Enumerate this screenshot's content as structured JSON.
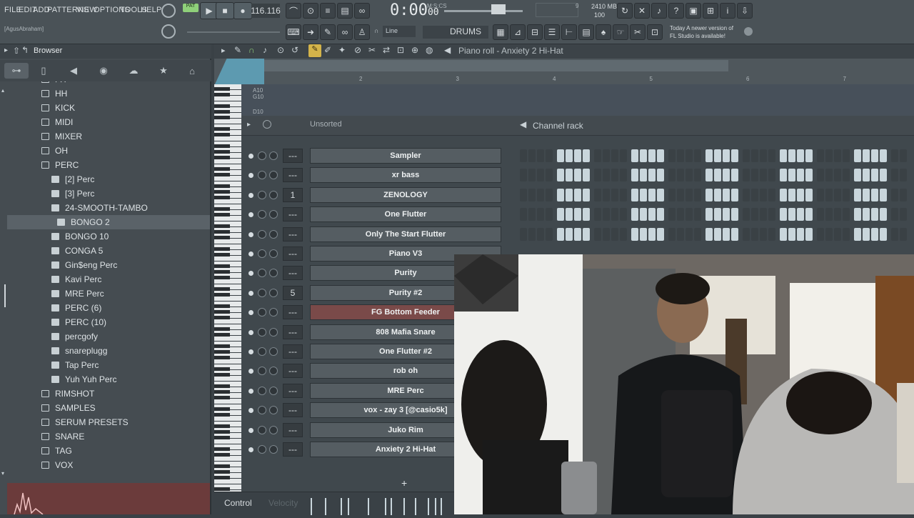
{
  "menu": [
    "FILE",
    "EDIT",
    "ADD",
    "PATTERNS",
    "VIEW",
    "OPTIONS",
    "TOOLS",
    "HELP"
  ],
  "transport": {
    "pat_label": "PAT",
    "tempo": "116.116",
    "time_main": "0:00",
    "time_sub": "00",
    "time_units": "M:S:CS",
    "mem_top": "2410 MB",
    "mem_bottom": "100",
    "cpu_label": "9",
    "user": "[AgusAbraham]",
    "snap_label": "Line",
    "pattern_name": "DRUMS",
    "news_line1": "Today  A newer version of",
    "news_line2": "FL Studio is available!"
  },
  "browser": {
    "title": "Browser",
    "items": [
      {
        "label": "FX",
        "depth": 0,
        "type": "folder"
      },
      {
        "label": "HH",
        "depth": 0,
        "type": "folder"
      },
      {
        "label": "KICK",
        "depth": 0,
        "type": "folder"
      },
      {
        "label": "MIDI",
        "depth": 0,
        "type": "folder"
      },
      {
        "label": "MIXER",
        "depth": 0,
        "type": "folder"
      },
      {
        "label": "OH",
        "depth": 0,
        "type": "folder"
      },
      {
        "label": "PERC",
        "depth": 0,
        "type": "folder-open"
      },
      {
        "label": "[2] Perc",
        "depth": 1,
        "type": "pack"
      },
      {
        "label": "[3] Perc",
        "depth": 1,
        "type": "pack"
      },
      {
        "label": "24-SMOOTH-TAMBO",
        "depth": 1,
        "type": "pack"
      },
      {
        "label": "BONGO 2",
        "depth": 2,
        "type": "pack",
        "selected": true
      },
      {
        "label": "BONGO 10",
        "depth": 1,
        "type": "pack"
      },
      {
        "label": "CONGA 5",
        "depth": 1,
        "type": "pack"
      },
      {
        "label": "Gin$eng Perc",
        "depth": 1,
        "type": "pack"
      },
      {
        "label": "Kavi Perc",
        "depth": 1,
        "type": "pack"
      },
      {
        "label": "MRE Perc",
        "depth": 1,
        "type": "pack"
      },
      {
        "label": "PERC (6)",
        "depth": 1,
        "type": "pack"
      },
      {
        "label": "PERC (10)",
        "depth": 1,
        "type": "pack"
      },
      {
        "label": "percgofy",
        "depth": 1,
        "type": "pack"
      },
      {
        "label": "snareplugg",
        "depth": 1,
        "type": "pack"
      },
      {
        "label": "Tap Perc",
        "depth": 1,
        "type": "pack"
      },
      {
        "label": "Yuh Yuh Perc",
        "depth": 1,
        "type": "pack"
      },
      {
        "label": "RIMSHOT",
        "depth": 0,
        "type": "folder"
      },
      {
        "label": "SAMPLES",
        "depth": 0,
        "type": "folder"
      },
      {
        "label": "SERUM PRESETS",
        "depth": 0,
        "type": "folder"
      },
      {
        "label": "SNARE",
        "depth": 0,
        "type": "folder"
      },
      {
        "label": "TAG",
        "depth": 0,
        "type": "folder"
      },
      {
        "label": "VOX",
        "depth": 0,
        "type": "folder"
      }
    ]
  },
  "piano_roll": {
    "title": "Piano roll - Anxiety 2 Hi-Hat",
    "bars": [
      "2",
      "3",
      "4",
      "5",
      "6",
      "7"
    ],
    "key_labels": [
      "A10",
      "G10",
      "D10"
    ]
  },
  "channel_rack": {
    "title": "Channel rack",
    "group": "Unsorted",
    "add_label": "+",
    "channels": [
      {
        "num": "---",
        "name": "Sampler"
      },
      {
        "num": "---",
        "name": "xr bass"
      },
      {
        "num": "1",
        "name": "ZENOLOGY"
      },
      {
        "num": "---",
        "name": "One Flutter"
      },
      {
        "num": "---",
        "name": "Only The Start Flutter"
      },
      {
        "num": "---",
        "name": "Piano V3"
      },
      {
        "num": "---",
        "name": "Purity"
      },
      {
        "num": "5",
        "name": "Purity #2"
      },
      {
        "num": "---",
        "name": "FG Bottom Feeder",
        "highlight": true
      },
      {
        "num": "---",
        "name": "808 Mafia Snare"
      },
      {
        "num": "---",
        "name": "One Flutter #2"
      },
      {
        "num": "---",
        "name": "rob oh"
      },
      {
        "num": "---",
        "name": "MRE Perc"
      },
      {
        "num": "---",
        "name": "vox - zay 3 [@casio5k]"
      },
      {
        "num": "---",
        "name": "Juko Rim"
      },
      {
        "num": "---",
        "name": "Anxiety 2 Hi-Hat"
      }
    ]
  },
  "control_strip": {
    "label": "Control",
    "sub": "Velocity"
  },
  "colors": {
    "accent": "#8fd07a",
    "step_on": "#c9d6dc",
    "step_off": "#3a4145",
    "highlight": "#7a4a49"
  }
}
